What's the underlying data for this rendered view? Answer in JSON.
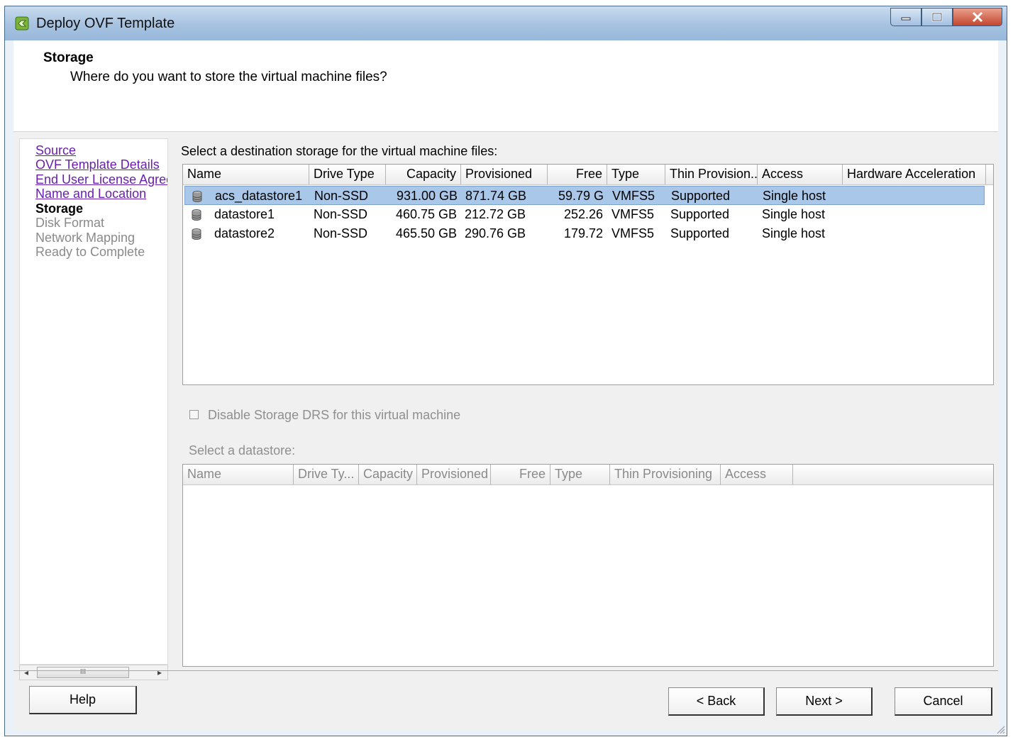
{
  "window": {
    "title": "Deploy OVF Template"
  },
  "header": {
    "title": "Storage",
    "subtitle": "Where do you want to store the virtual machine files?"
  },
  "nav": {
    "items": [
      {
        "label": "Source",
        "state": "link"
      },
      {
        "label": "OVF Template Details",
        "state": "link"
      },
      {
        "label": "End User License Agreement",
        "state": "link"
      },
      {
        "label": "Name and Location",
        "state": "link"
      },
      {
        "label": "Storage",
        "state": "current"
      },
      {
        "label": "Disk Format",
        "state": "disabled"
      },
      {
        "label": "Network Mapping",
        "state": "disabled"
      },
      {
        "label": "Ready to Complete",
        "state": "disabled"
      }
    ],
    "scroll_thumb": "III"
  },
  "storage": {
    "prompt": "Select a destination storage for the virtual machine files:",
    "columns": [
      "Name",
      "Drive Type",
      "Capacity",
      "Provisioned",
      "Free",
      "Type",
      "Thin Provision...",
      "Access",
      "Hardware Acceleration"
    ],
    "rows": [
      {
        "name": "acs_datastore1",
        "drive_type": "Non-SSD",
        "capacity": "931.00 GB",
        "provisioned": "871.74 GB",
        "free": "59.79 G",
        "type": "VMFS5",
        "thin": "Supported",
        "access": "Single host",
        "hw": "",
        "selected": true
      },
      {
        "name": "datastore1",
        "drive_type": "Non-SSD",
        "capacity": "460.75 GB",
        "provisioned": "212.72 GB",
        "free": "252.26",
        "type": "VMFS5",
        "thin": "Supported",
        "access": "Single host",
        "hw": "",
        "selected": false
      },
      {
        "name": "datastore2",
        "drive_type": "Non-SSD",
        "capacity": "465.50 GB",
        "provisioned": "290.76 GB",
        "free": "179.72",
        "type": "VMFS5",
        "thin": "Supported",
        "access": "Single host",
        "hw": "",
        "selected": false
      }
    ]
  },
  "drs": {
    "checkbox_label": "Disable Storage DRS for this virtual machine",
    "checked": false
  },
  "datastore": {
    "prompt": "Select a datastore:",
    "columns": [
      "Name",
      "Drive Ty...",
      "Capacity",
      "Provisioned",
      "Free",
      "Type",
      "Thin Provisioning",
      "Access"
    ]
  },
  "buttons": {
    "help": "Help",
    "back": "< Back",
    "next": "Next >",
    "cancel": "Cancel"
  },
  "colors": {
    "selection": "#a9c7e8",
    "link": "#6a1fb0",
    "titlebar": "#a9c4e2"
  }
}
